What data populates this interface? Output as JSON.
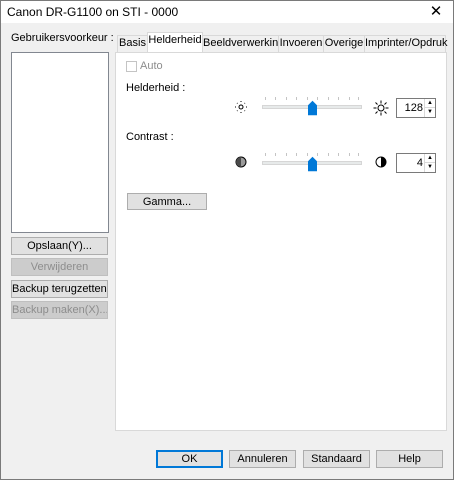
{
  "window": {
    "title": "Canon DR-G1100 on STI - 0000",
    "close_glyph": "✕"
  },
  "sidebar": {
    "label": "Gebruikersvoorkeur :",
    "buttons": {
      "save": "Opslaan(Y)...",
      "delete": "Verwijderen",
      "restore_backup": "Backup terugzetten...",
      "make_backup": "Backup maken(X)..."
    }
  },
  "tabs": [
    {
      "label": "Basis"
    },
    {
      "label": "Helderheid"
    },
    {
      "label": "Beeldverwerking"
    },
    {
      "label": "Invoeren"
    },
    {
      "label": "Overige"
    },
    {
      "label": "Imprinter/Opdruk"
    }
  ],
  "active_tab": "Helderheid",
  "panel": {
    "auto_label": "Auto",
    "auto_checked": false,
    "brightness": {
      "label": "Helderheid :",
      "value": "128",
      "level": 0.5,
      "icon_low": "brightness-low-icon",
      "icon_high": "brightness-high-icon"
    },
    "contrast": {
      "label": "Contrast :",
      "value": "4",
      "level": 0.5,
      "icon_low": "contrast-low-icon",
      "icon_high": "contrast-high-icon"
    },
    "gamma_button": "Gamma..."
  },
  "footer": {
    "ok": "OK",
    "cancel": "Annuleren",
    "default": "Standaard",
    "help": "Help"
  },
  "colors": {
    "accent": "#0078d7",
    "slider_thumb": "#0078d7",
    "disabled_text": "#8d8d8d"
  }
}
